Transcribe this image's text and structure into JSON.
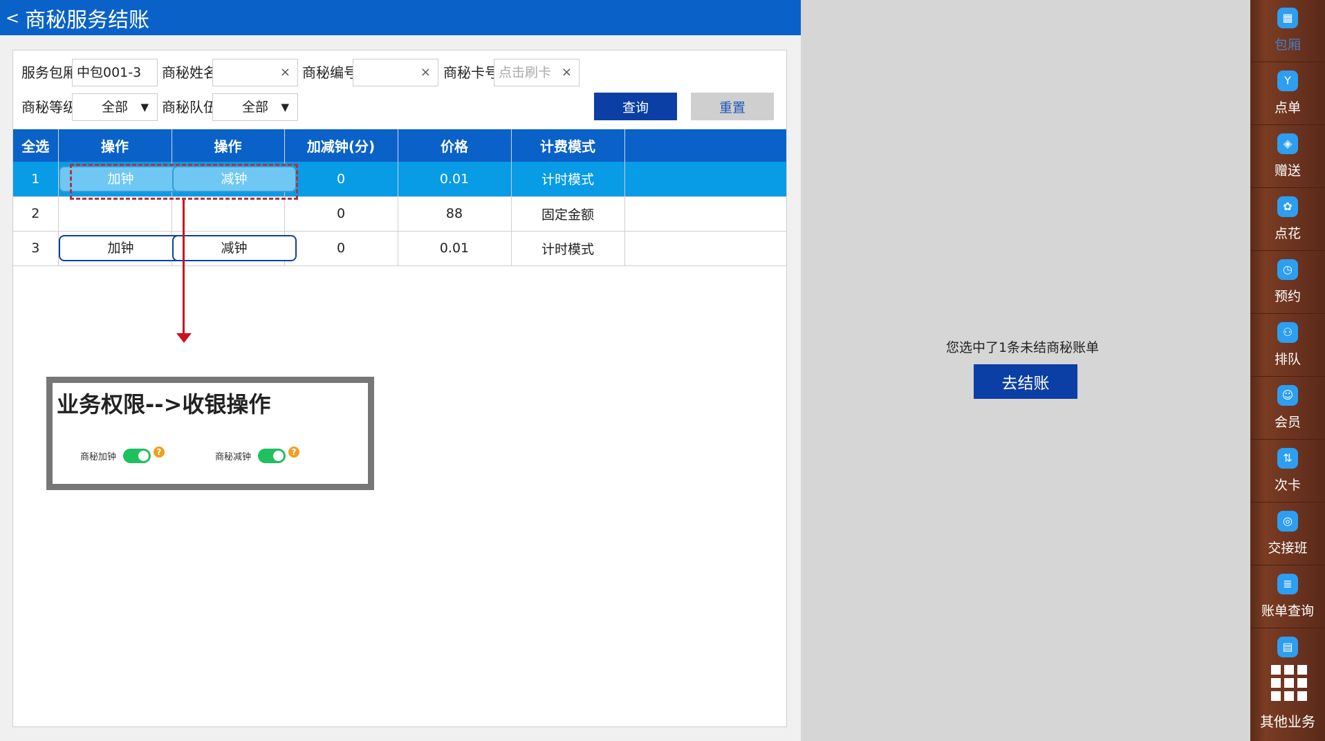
{
  "header": {
    "back_symbol": "<",
    "title": "商秘服务结账"
  },
  "filters": {
    "room_label": "服务包厢",
    "room_value": "中包001-3",
    "name_label": "商秘姓名",
    "name_value": "",
    "number_label": "商秘编号",
    "number_value": "",
    "card_label": "商秘卡号",
    "card_placeholder": "点击刷卡",
    "level_label": "商秘等级",
    "level_value": "全部",
    "team_label": "商秘队伍",
    "team_value": "全部",
    "clear_symbol": "×",
    "query_button": "查询",
    "reset_button": "重置"
  },
  "table": {
    "headers": [
      "全选",
      "操作",
      "操作",
      "加减钟(分)",
      "价格",
      "计费模式"
    ],
    "add_label": "加钟",
    "sub_label": "减钟",
    "rows": [
      {
        "index": "1",
        "minutes": "0",
        "price": "0.01",
        "mode": "计时模式",
        "has_buttons": true,
        "selected": true
      },
      {
        "index": "2",
        "minutes": "0",
        "price": "88",
        "mode": "固定金额",
        "has_buttons": false,
        "selected": false
      },
      {
        "index": "3",
        "minutes": "0",
        "price": "0.01",
        "mode": "计时模式",
        "has_buttons": true,
        "selected": false
      }
    ]
  },
  "permission": {
    "title": "业务权限-->收银操作",
    "add_label": "商秘加钟",
    "sub_label": "商秘减钟",
    "help_symbol": "?"
  },
  "summary": {
    "message": "您选中了1条未结商秘账单",
    "checkout_button": "去结账"
  },
  "sidenav": {
    "items": [
      {
        "label": "包厢",
        "icon": "grid-icon",
        "glyph": "▦"
      },
      {
        "label": "点单",
        "icon": "cocktail-icon",
        "glyph": "Y"
      },
      {
        "label": "赠送",
        "icon": "gift-icon",
        "glyph": "◈"
      },
      {
        "label": "点花",
        "icon": "flower-icon",
        "glyph": "✿"
      },
      {
        "label": "预约",
        "icon": "clock-icon",
        "glyph": "◷"
      },
      {
        "label": "排队",
        "icon": "queue-icon",
        "glyph": "⚇"
      },
      {
        "label": "会员",
        "icon": "member-icon",
        "glyph": "☺"
      },
      {
        "label": "次卡",
        "icon": "card-icon",
        "glyph": "⇅"
      },
      {
        "label": "交接班",
        "icon": "shift-icon",
        "glyph": "◎"
      },
      {
        "label": "账单查询",
        "icon": "bill-search-icon",
        "glyph": "≣"
      },
      {
        "label": "",
        "icon": "report-icon",
        "glyph": "▤"
      }
    ],
    "more_label": "其他业务"
  },
  "colors": {
    "primary": "#0a62c8",
    "selected_row": "#089be6",
    "dark_button": "#0b3fa5",
    "arrow": "#cc1020",
    "toggle_on": "#1ec060"
  }
}
